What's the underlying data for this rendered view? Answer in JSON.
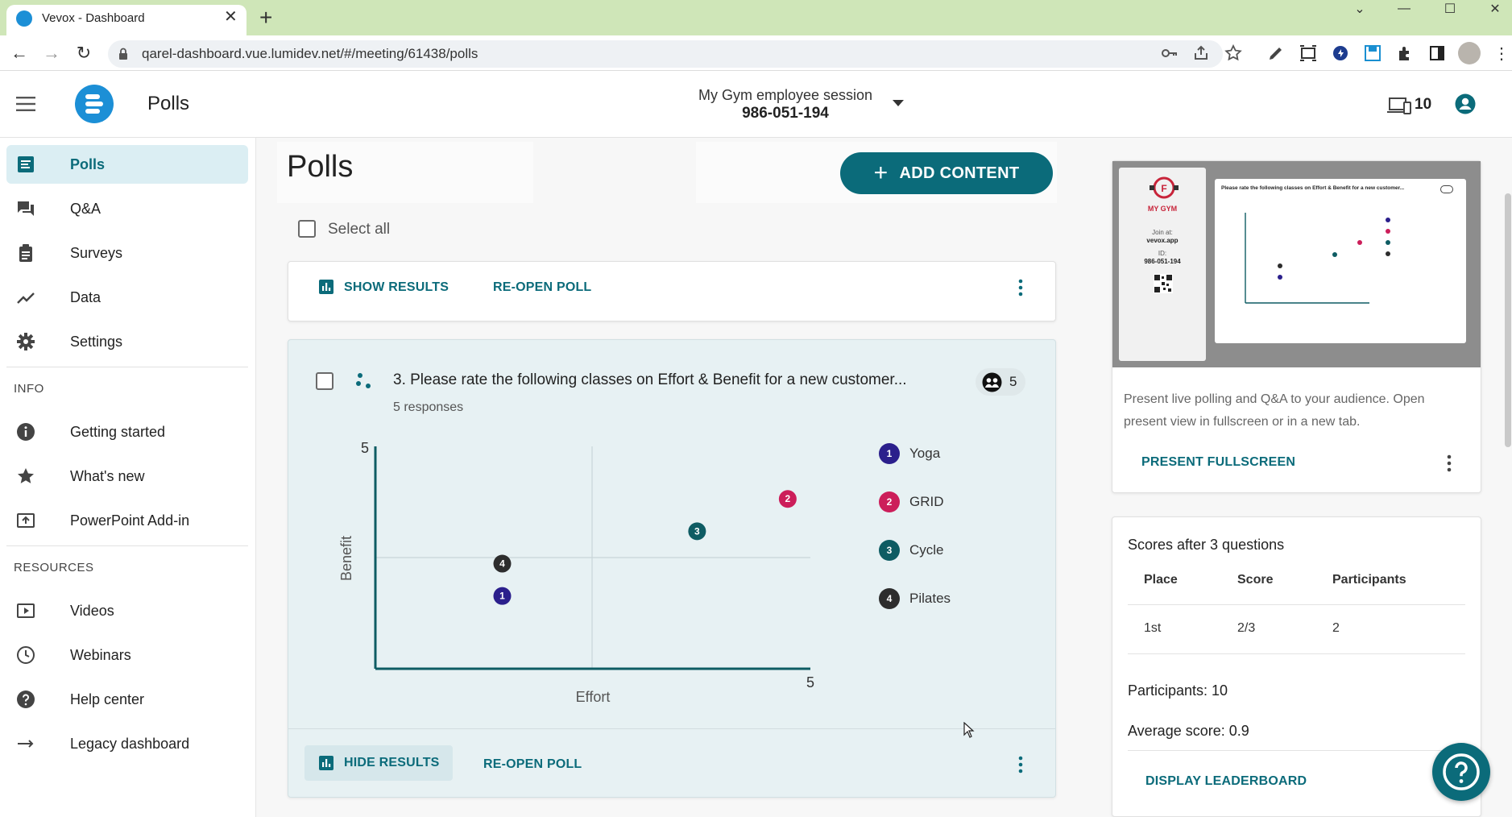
{
  "browser": {
    "tab_title": "Vevox - Dashboard",
    "url": "qarel-dashboard.vue.lumidev.net/#/meeting/61438/polls"
  },
  "header": {
    "title": "Polls",
    "session_name": "My Gym employee session",
    "session_code": "986-051-194",
    "device_count": "10"
  },
  "sidebar": {
    "items": [
      {
        "label": "Polls",
        "icon": "polls-icon"
      },
      {
        "label": "Q&A",
        "icon": "qa-icon"
      },
      {
        "label": "Surveys",
        "icon": "surveys-icon"
      },
      {
        "label": "Data",
        "icon": "data-icon"
      },
      {
        "label": "Settings",
        "icon": "gear-icon"
      }
    ],
    "info_heading": "INFO",
    "info_items": [
      {
        "label": "Getting started",
        "icon": "info-icon"
      },
      {
        "label": "What's new",
        "icon": "star-icon"
      },
      {
        "label": "PowerPoint Add-in",
        "icon": "powerpoint-icon"
      }
    ],
    "resources_heading": "RESOURCES",
    "resources_items": [
      {
        "label": "Videos",
        "icon": "video-icon"
      },
      {
        "label": "Webinars",
        "icon": "clock-icon"
      },
      {
        "label": "Help center",
        "icon": "help-icon"
      },
      {
        "label": "Legacy dashboard",
        "icon": "arrow-right-icon"
      }
    ]
  },
  "main": {
    "heading": "Polls",
    "add_content": "ADD CONTENT",
    "select_all": "Select all",
    "card1": {
      "show_results": "SHOW RESULTS",
      "reopen": "RE-OPEN POLL"
    },
    "card2": {
      "question": "3. Please rate the following classes on Effort & Benefit for a new customer...",
      "responses": "5 responses",
      "participant_count": "5",
      "hide_results": "HIDE RESULTS",
      "reopen": "RE-OPEN POLL"
    }
  },
  "chart_data": {
    "type": "scatter",
    "xlabel": "Effort",
    "ylabel": "Benefit",
    "xlim": [
      0,
      5
    ],
    "ylim": [
      0,
      5
    ],
    "x_max_label": "5",
    "y_max_label": "5",
    "midlines": true,
    "legend_position": "right",
    "series": [
      {
        "name": "Yoga",
        "number": "1",
        "color": "#2b1f8c",
        "x": 2.8,
        "y": 1.8
      },
      {
        "name": "GRID",
        "number": "2",
        "color": "#cc1e5a",
        "x": 9.1,
        "y": 4.2
      },
      {
        "name": "Cycle",
        "number": "3",
        "color": "#0e5c63",
        "x": 7.1,
        "y": 3.4
      },
      {
        "name": "Pilates",
        "number": "4",
        "color": "#2d2d2d",
        "x": 2.8,
        "y": 2.6
      }
    ]
  },
  "right_panel": {
    "preview": {
      "gym_name": "MY GYM",
      "join_at": "Join at:",
      "join_url": "vevox.app",
      "id_label": "ID:",
      "id_value": "986-051-194",
      "slide_title": "Please rate the following classes on Effort & Benefit for a new customer..."
    },
    "present_text": "Present live polling and Q&A to your audience. Open present view in fullscreen or in a new tab.",
    "present_fullscreen": "PRESENT FULLSCREEN",
    "scores": {
      "title": "Scores after 3 questions",
      "columns": [
        "Place",
        "Score",
        "Participants"
      ],
      "rows": [
        [
          "1st",
          "2/3",
          "2"
        ]
      ],
      "participants": "Participants: 10",
      "average": "Average score: 0.9",
      "leaderboard": "DISPLAY LEADERBOARD"
    }
  },
  "colors": {
    "accent": "#0b6b7a",
    "tabbar": "#cfe6b8"
  }
}
